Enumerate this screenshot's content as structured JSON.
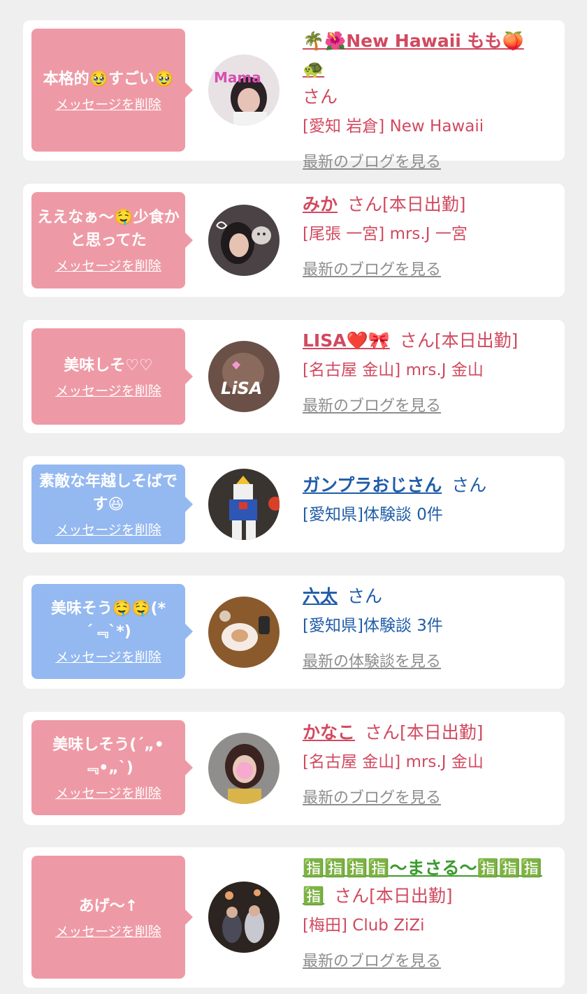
{
  "colors": {
    "pink_bubble": "#ee9aa6",
    "blue_bubble": "#94b8f0",
    "pink_text": "#d1495f",
    "blue_text": "#1f5ca8",
    "green_text": "#3b9b2d",
    "link_gray": "#8d8d8d"
  },
  "cards": [
    {
      "bubble_color": "pink",
      "message": "本格的🥹すごい🥹",
      "delete_label": "メッセージを削除",
      "avatar_icon": "girl-photo-avatar",
      "name": "🌴🌺New Hawaii もも🍑🐢",
      "name_color": "pink",
      "san": "さん",
      "shop": "[愛知 岩倉] New Hawaii",
      "link": "最新のブログを見る"
    },
    {
      "bubble_color": "pink",
      "message": "ええなぁ〜🤤少食かと思ってた",
      "delete_label": "メッセージを削除",
      "avatar_icon": "girl-with-cat-avatar",
      "name": "みか",
      "name_color": "pink",
      "san": "さん[本日出勤]",
      "shop": "[尾張 一宮] mrs.J 一宮",
      "link": "最新のブログを見る"
    },
    {
      "bubble_color": "pink",
      "message": "美味しそ♡♡",
      "delete_label": "メッセージを削除",
      "avatar_icon": "lisa-avatar",
      "name": "LISA❤️🎀",
      "name_color": "pink",
      "san": "さん[本日出勤]",
      "shop": "[名古屋 金山] mrs.J 金山",
      "link": "最新のブログを見る"
    },
    {
      "bubble_color": "blue",
      "message": "素敵な年越しそばです😆",
      "delete_label": "メッセージを削除",
      "avatar_icon": "gundam-robot-avatar",
      "name": "ガンプラおじさん",
      "name_color": "blue",
      "san": "さん",
      "shop": "[愛知県]体験談 0件",
      "link": ""
    },
    {
      "bubble_color": "blue",
      "message": "美味そう🤤🤤(*´﹃`*)",
      "delete_label": "メッセージを削除",
      "avatar_icon": "dinner-plate-avatar",
      "name": "六太",
      "name_color": "blue",
      "san": "さん",
      "shop": "[愛知県]体験談 3件",
      "link": "最新の体験談を見る"
    },
    {
      "bubble_color": "pink",
      "message": "美味しそう(´„• ﹃•„`)",
      "delete_label": "メッセージを削除",
      "avatar_icon": "girl-blurred-face-avatar",
      "name": "かなこ",
      "name_color": "pink",
      "san": "さん[本日出勤]",
      "shop": "[名古屋 金山] mrs.J 金山",
      "link": "最新のブログを見る"
    },
    {
      "bubble_color": "pink",
      "message": "あげ〜↑",
      "delete_label": "メッセージを削除",
      "avatar_icon": "group-photo-avatar",
      "name": "🈯🈯🈯🈯〜まさる〜🈯🈯🈯🈯",
      "name_color": "green",
      "san": "さん[本日出勤]",
      "shop": "[梅田] Club ZiZi",
      "link": "最新のブログを見る"
    }
  ]
}
